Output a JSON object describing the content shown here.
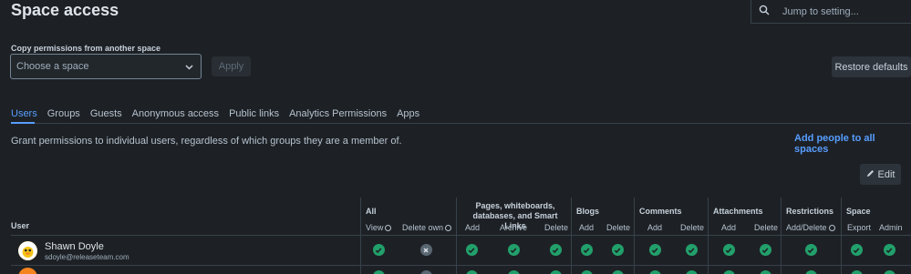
{
  "page": {
    "title": "Space access"
  },
  "search": {
    "placeholder": "Jump to setting..."
  },
  "copy": {
    "label": "Copy permissions from another space",
    "select_placeholder": "Choose a space",
    "apply_label": "Apply"
  },
  "restore_label": "Restore defaults",
  "tabs": [
    {
      "label": "Users",
      "active": true
    },
    {
      "label": "Groups"
    },
    {
      "label": "Guests"
    },
    {
      "label": "Anonymous access"
    },
    {
      "label": "Public links"
    },
    {
      "label": "Analytics Permissions"
    },
    {
      "label": "Apps"
    }
  ],
  "grant_text": "Grant permissions to individual users, regardless of which groups they are a member of.",
  "add_people_label": "Add people to all spaces",
  "edit_label": "Edit",
  "table": {
    "user_header": "User",
    "groups": [
      {
        "label": "All",
        "columns": [
          "View",
          "Delete own"
        ]
      },
      {
        "label": "Pages, whiteboards, databases, and Smart Links",
        "columns": [
          "Add",
          "Archive",
          "Delete"
        ]
      },
      {
        "label": "Blogs",
        "columns": [
          "Add",
          "Delete"
        ]
      },
      {
        "label": "Comments",
        "columns": [
          "Add",
          "Delete"
        ]
      },
      {
        "label": "Attachments",
        "columns": [
          "Add",
          "Delete"
        ]
      },
      {
        "label": "Restrictions",
        "columns": [
          "Add/Delete"
        ]
      },
      {
        "label": "Space",
        "columns": [
          "Export",
          "Admin"
        ]
      }
    ],
    "rows": [
      {
        "name": "Shawn Doyle",
        "email": "sdoyle@releaseteam.com",
        "permissions": [
          true,
          false,
          true,
          true,
          true,
          true,
          true,
          true,
          true,
          true,
          true,
          true,
          true,
          true
        ]
      }
    ]
  },
  "colors": {
    "accent": "#579dff",
    "check": "#22a06b",
    "off": "#596773",
    "background": "#1d2125"
  }
}
